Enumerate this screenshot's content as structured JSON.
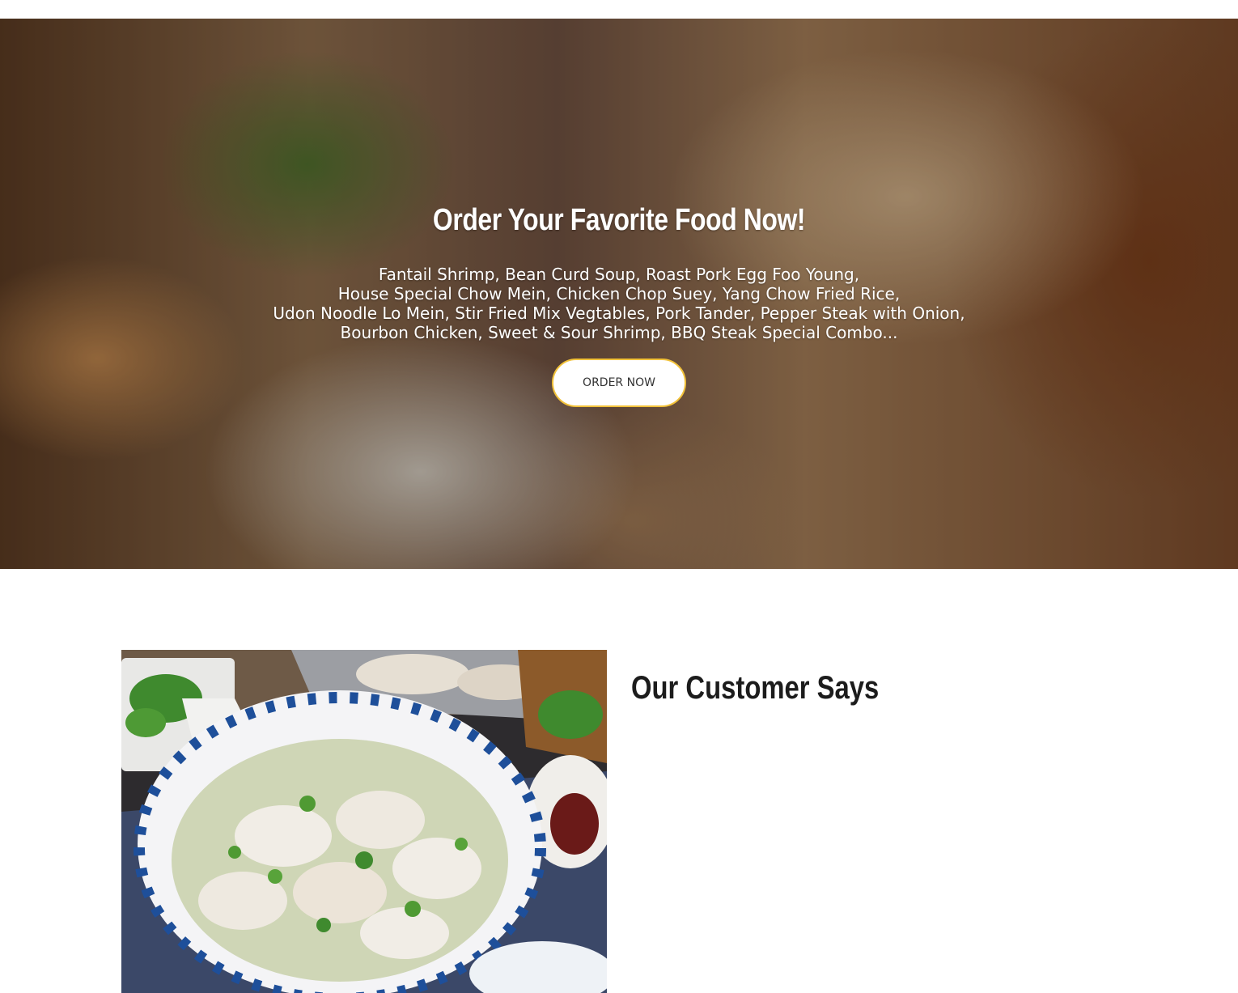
{
  "hero": {
    "title": "Order Your Favorite Food Now!",
    "description_lines": [
      "Fantail Shrimp, Bean Curd Soup, Roast Pork Egg Foo Young,",
      "House Special Chow Mein, Chicken Chop Suey, Yang Chow Fried Rice,",
      "Udon Noodle Lo Mein, Stir Fried Mix Vegtables, Pork Tander, Pepper Steak with Onion,",
      "Bourbon Chicken, Sweet & Sour Shrimp, BBQ Steak Special Combo..."
    ],
    "button_label": "ORDER NOW"
  },
  "testimonials": {
    "heading": "Our Customer Says"
  },
  "colors": {
    "button_border": "#f2c23a",
    "heading_text": "#1c1c1c",
    "hero_text": "#ffffff"
  }
}
